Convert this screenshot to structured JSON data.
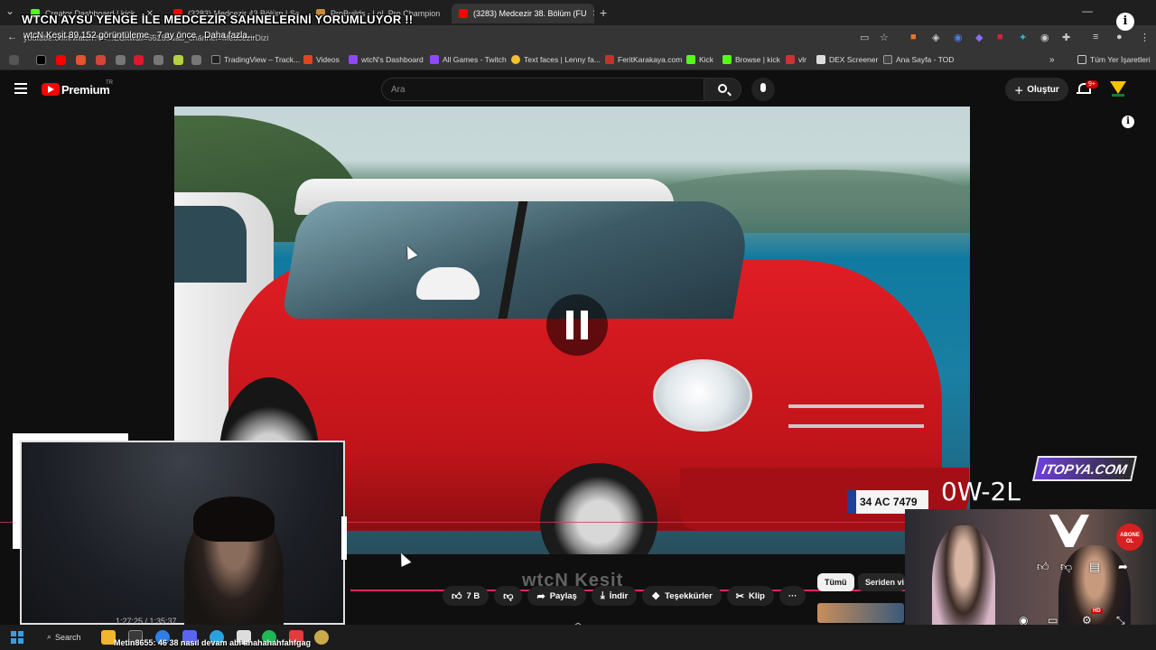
{
  "browser": {
    "tabs": [
      {
        "label": "Creator Dashboard | kick",
        "active": false
      },
      {
        "label": "(3283) Medcezir 43.Bölüm | So",
        "active": false
      },
      {
        "label": "ProBuilds - LoL Pro Champion",
        "active": false
      },
      {
        "label": "(3283) Medcezir 38. Bölüm (FU",
        "active": true
      }
    ],
    "new_tab": "+",
    "url": "youtube.com/watch?v=...EGkw&t=6625s&ab_channel=MedcezirDizi",
    "bookmarks": [
      {
        "label": "TradingView – Track..."
      },
      {
        "label": "Videos"
      },
      {
        "label": "wtcN's Dashboard"
      },
      {
        "label": "All Games - Twitch"
      },
      {
        "label": "Text faces | Lenny fa..."
      },
      {
        "label": "FeritKarakaya.com"
      },
      {
        "label": "Kick"
      },
      {
        "label": "Browse | kick"
      },
      {
        "label": "vlr"
      },
      {
        "label": "DEX Screener"
      },
      {
        "label": "Ana Sayfa - TOD"
      }
    ],
    "bookmarks_folder": "Tüm Yer İşaretleri"
  },
  "stream": {
    "title": "WTCN AYSU YENGE İLE MEDCEZİR SAHNELERİNİ YORUMLUYOR !!",
    "meta": "wtcN Keşit   89.152 görüntüleme · 7 ay önce · Daha fazla...",
    "watermark": "wtcN Keşit",
    "ticker": "Metin8655: 46 38 nasıl devam abi ahahahahfahfgag",
    "score": "0W-2L",
    "brand_logo": "ITOPYA.COM",
    "cam_time": "1:27:25 / 1:35:37",
    "abone_badge": "ABONE OL"
  },
  "youtube": {
    "brand": "Premium",
    "region": "TR",
    "search_placeholder": "Ara",
    "create_label": "Oluştur",
    "notifications_badge": "9+",
    "actions": {
      "likes": "7 B",
      "share": "Paylaş",
      "download": "İndir",
      "thanks": "Teşekkürler",
      "clip": "Klip",
      "more": "···"
    },
    "chips": {
      "all": "Tümü",
      "series": "Seriden vi"
    },
    "plate": "34 AC 7479"
  },
  "taskbar": {
    "search_label": "Search"
  },
  "colors": {
    "youtube_red": "#ff0000",
    "progress": "#e0245e",
    "taskbar": "#1c1c1c"
  }
}
